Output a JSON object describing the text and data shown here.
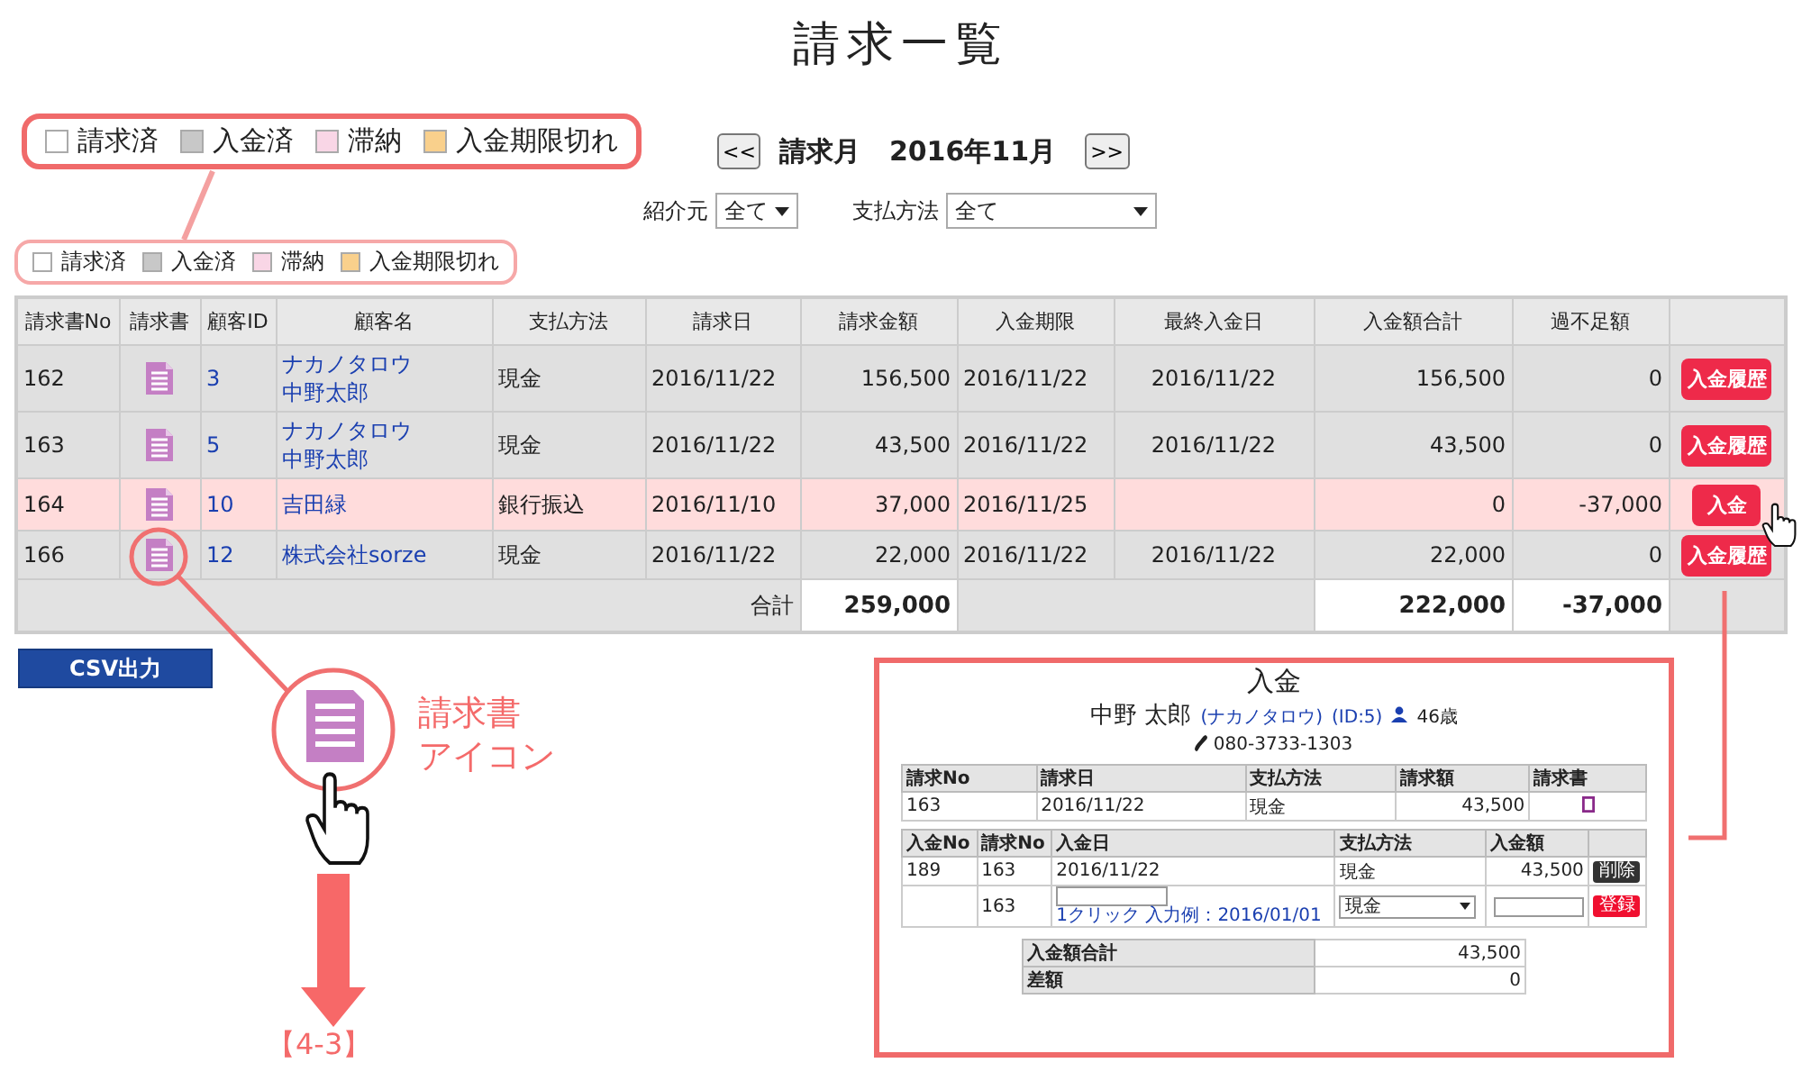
{
  "title": "請求一覧",
  "legend_callout": [
    {
      "label": "請求済",
      "color": "#ffffff"
    },
    {
      "label": "入金済",
      "color": "#c8c8c8"
    },
    {
      "label": "滞納",
      "color": "#f9d6e6"
    },
    {
      "label": "入金期限切れ",
      "color": "#f9d08c"
    }
  ],
  "month_nav": {
    "prev": "<<",
    "label": "請求月",
    "month": "2016年11月",
    "next": ">>"
  },
  "filters": [
    {
      "label": "紹介元",
      "value": "全て"
    },
    {
      "label": "支払方法",
      "value": "全て"
    }
  ],
  "legend": [
    {
      "label": "請求済",
      "color": "#ffffff"
    },
    {
      "label": "入金済",
      "color": "#c8c8c8"
    },
    {
      "label": "滞納",
      "color": "#f9d6e6"
    },
    {
      "label": "入金期限切れ",
      "color": "#f9d08c"
    }
  ],
  "table": {
    "columns": [
      "請求書No",
      "請求書",
      "顧客ID",
      "顧客名",
      "支払方法",
      "請求日",
      "請求金額",
      "入金期限",
      "最終入金日",
      "入金額合計",
      "過不足額"
    ],
    "rows": [
      {
        "kind": "paid",
        "no": "162",
        "customer_id": "3",
        "kana": "ナカノタロウ",
        "name": "中野太郎",
        "payment": "現金",
        "invoice_date": "2016/11/22",
        "amount": "156,500",
        "due": "2016/11/22",
        "last_paid": "2016/11/22",
        "paid_total": "156,500",
        "balance": "0",
        "action": {
          "kind": "history",
          "label": "入金履歴"
        }
      },
      {
        "kind": "paid",
        "no": "163",
        "customer_id": "5",
        "kana": "ナカノタロウ",
        "name": "中野太郎",
        "payment": "現金",
        "invoice_date": "2016/11/22",
        "amount": "43,500",
        "due": "2016/11/22",
        "last_paid": "2016/11/22",
        "paid_total": "43,500",
        "balance": "0",
        "action": {
          "kind": "history",
          "label": "入金履歴"
        }
      },
      {
        "kind": "overdue",
        "no": "164",
        "customer_id": "10",
        "name": "吉田緑",
        "payment": "銀行振込",
        "invoice_date": "2016/11/10",
        "amount": "37,000",
        "due": "2016/11/25",
        "paid_total": "0",
        "balance": "-37,000",
        "action": {
          "kind": "pay",
          "label": "入金"
        }
      },
      {
        "kind": "paid",
        "no": "166",
        "customer_id": "12",
        "name": "株式会社sorze",
        "payment": "現金",
        "invoice_date": "2016/11/22",
        "amount": "22,000",
        "due": "2016/11/22",
        "last_paid": "2016/11/22",
        "paid_total": "22,000",
        "balance": "0",
        "action": {
          "kind": "history",
          "label": "入金履歴"
        }
      }
    ],
    "totals": {
      "label": "合計",
      "amount": "259,000",
      "paid_total": "222,000",
      "balance": "-37,000"
    }
  },
  "csv_button": "CSV出力",
  "icon_callout": {
    "label_lines": [
      "請求書",
      "アイコン"
    ],
    "ref": "【4-3】"
  },
  "payment_dialog": {
    "title": "入金",
    "name": "中野 太郎",
    "kana": "(ナカノタロウ)",
    "id": "(ID:5)",
    "age": "46歳",
    "phone": "080-3733-1303",
    "invoice_table": {
      "columns": [
        "請求No",
        "請求日",
        "支払方法",
        "請求額",
        "請求書"
      ],
      "row": {
        "no": "163",
        "date": "2016/11/22",
        "payment": "現金",
        "amount": "43,500"
      }
    },
    "payment_table": {
      "columns": [
        "入金No",
        "請求No",
        "入金日",
        "支払方法",
        "入金額"
      ],
      "rows": [
        {
          "kind": "record",
          "no": "189",
          "invoice_no": "163",
          "date": "2016/11/22",
          "payment": "現金",
          "amount": "43,500",
          "button": "削除"
        },
        {
          "kind": "entry",
          "invoice_no": "163",
          "hint": "1クリック 入力例：2016/01/01",
          "payment": "現金",
          "button": "登録"
        }
      ]
    },
    "summary": [
      {
        "label": "入金額合計",
        "value": "43,500"
      },
      {
        "label": "差額",
        "value": "0"
      }
    ]
  }
}
